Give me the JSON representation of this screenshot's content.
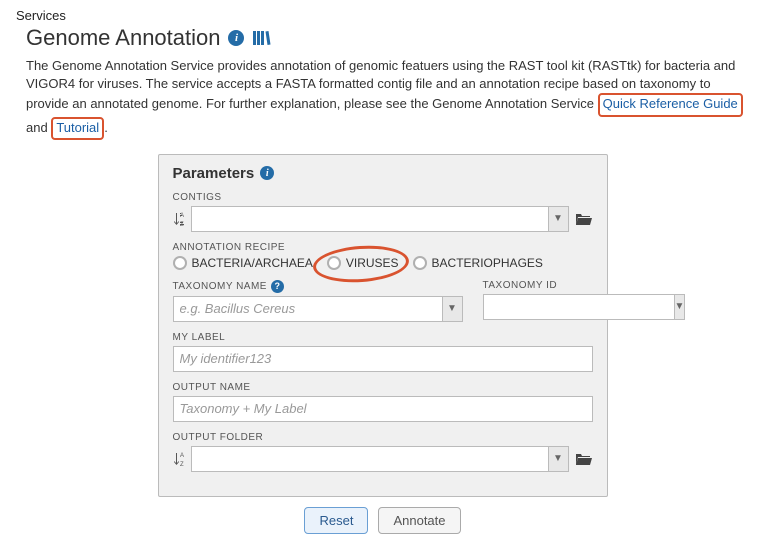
{
  "breadcrumb": "Services",
  "title": "Genome Annotation",
  "description_parts": {
    "p1": "The Genome Annotation Service provides annotation of genomic featuers using the RAST tool kit (RASTtk) for bacteria and VIGOR4 for viruses. The service accepts a FASTA formatted contig file and an annotation recipe based on taxonomy to provide an annotated genome. For further explanation, please see the Genome Annotation Service ",
    "link1": "Quick Reference Guide",
    "mid": " and ",
    "link2": "Tutorial",
    "end": "."
  },
  "panel": {
    "title": "Parameters",
    "contigs_label": "CONTIGS",
    "recipe_label": "ANNOTATION RECIPE",
    "recipe_opts": {
      "bacteria": "BACTERIA/ARCHAEA",
      "viruses": "VIRUSES",
      "phages": "BACTERIOPHAGES"
    },
    "taxon_name_label": "TAXONOMY NAME",
    "taxon_name_placeholder": "e.g. Bacillus Cereus",
    "taxon_id_label": "TAXONOMY ID",
    "mylabel_label": "MY LABEL",
    "mylabel_placeholder": "My identifier123",
    "outname_label": "OUTPUT NAME",
    "outname_placeholder": "Taxonomy + My Label",
    "outfolder_label": "OUTPUT FOLDER"
  },
  "buttons": {
    "reset": "Reset",
    "annotate": "Annotate"
  }
}
